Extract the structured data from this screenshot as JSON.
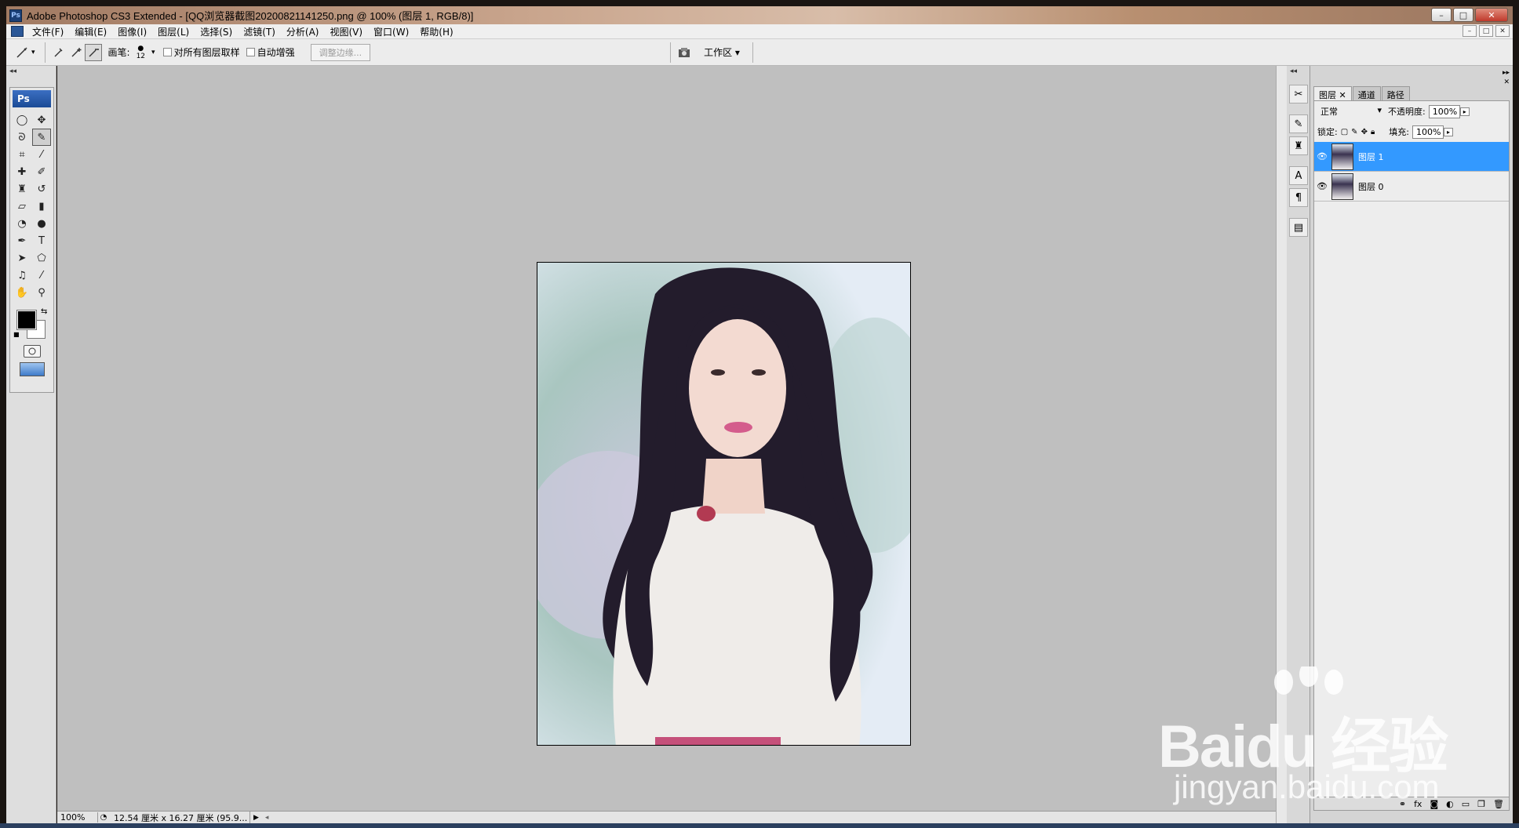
{
  "window": {
    "title": "Adobe Photoshop CS3 Extended - [QQ浏览器截图20200821141250.png @ 100% (图层 1, RGB/8)]",
    "app_badge": "Ps",
    "min_glyph": "–",
    "max_glyph": "□",
    "close_glyph": "✕"
  },
  "menu": {
    "items": [
      "文件(F)",
      "编辑(E)",
      "图像(I)",
      "图层(L)",
      "选择(S)",
      "滤镜(T)",
      "分析(A)",
      "视图(V)",
      "窗口(W)",
      "帮助(H)"
    ]
  },
  "options": {
    "brush_label": "画笔:",
    "brush_size": "12",
    "sample_all_layers": "对所有图层取样",
    "auto_enhance": "自动增强",
    "refine_edge": "调整边缘...",
    "workspace": "工作区 ▾"
  },
  "toolbox": {
    "banner": "Ps",
    "tools": [
      {
        "name": "marquee-tool-icon",
        "glyph": "◯"
      },
      {
        "name": "move-tool-icon",
        "glyph": "✥"
      },
      {
        "name": "lasso-tool-icon",
        "glyph": "ᘐ"
      },
      {
        "name": "quick-selection-tool-icon",
        "glyph": "✎"
      },
      {
        "name": "crop-tool-icon",
        "glyph": "⌗"
      },
      {
        "name": "slice-tool-icon",
        "glyph": "⁄"
      },
      {
        "name": "healing-brush-icon",
        "glyph": "✚"
      },
      {
        "name": "brush-tool-icon",
        "glyph": "✐"
      },
      {
        "name": "clone-stamp-icon",
        "glyph": "♜"
      },
      {
        "name": "history-brush-icon",
        "glyph": "↺"
      },
      {
        "name": "eraser-tool-icon",
        "glyph": "▱"
      },
      {
        "name": "gradient-tool-icon",
        "glyph": "▮"
      },
      {
        "name": "blur-tool-icon",
        "glyph": "◔"
      },
      {
        "name": "dodge-tool-icon",
        "glyph": "●"
      },
      {
        "name": "pen-tool-icon",
        "glyph": "✒"
      },
      {
        "name": "type-tool-icon",
        "glyph": "T"
      },
      {
        "name": "path-selection-icon",
        "glyph": "➤"
      },
      {
        "name": "shape-tool-icon",
        "glyph": "⬠"
      },
      {
        "name": "notes-tool-icon",
        "glyph": "♫"
      },
      {
        "name": "eyedropper-tool-icon",
        "glyph": "⁄"
      },
      {
        "name": "hand-tool-icon",
        "glyph": "✋"
      },
      {
        "name": "zoom-tool-icon",
        "glyph": "⚲"
      }
    ]
  },
  "status": {
    "zoom": "100%",
    "doc_info": "12.54 厘米 x 16.27 厘米 (95.9..."
  },
  "layers_panel": {
    "tabs": [
      "图层 ✕",
      "通道",
      "路径"
    ],
    "blend_mode": "正常",
    "opacity_label": "不透明度:",
    "opacity_value": "100%",
    "lock_label": "锁定:",
    "fill_label": "填充:",
    "fill_value": "100%",
    "layers": [
      {
        "name": "图层 1",
        "selected": true
      },
      {
        "name": "图层 0",
        "selected": false
      }
    ]
  },
  "watermark": {
    "brand": "Baidu 经验",
    "url": "jingyan.baidu.com"
  }
}
